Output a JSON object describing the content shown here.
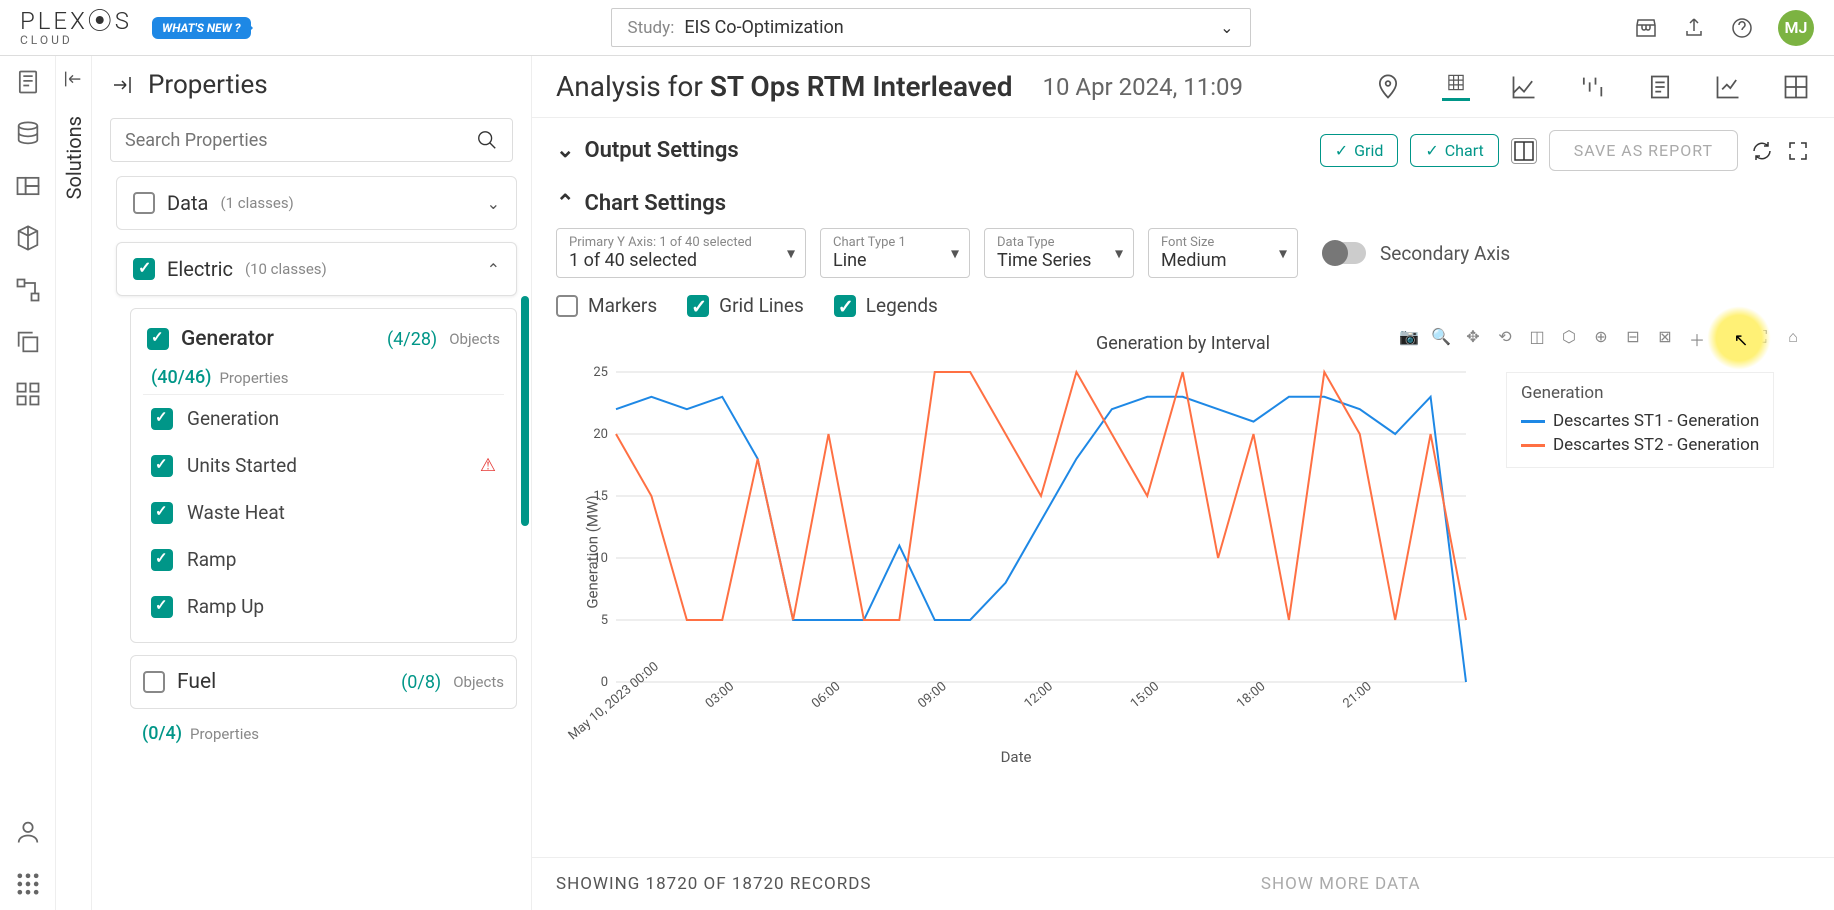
{
  "topbar": {
    "logo_main": "PLEX⦿S",
    "logo_sub": "CLOUD",
    "whats_new": "WHAT'S NEW ?",
    "study_label": "Study:",
    "study_value": "EIS Co-Optimization",
    "avatar": "MJ"
  },
  "analysis": {
    "prefix": "Analysis for ",
    "name": "ST Ops RTM Interleaved",
    "date": "10 Apr 2024, 11:09"
  },
  "props": {
    "title": "Properties",
    "search_placeholder": "Search Properties",
    "groups": {
      "data": {
        "name": "Data",
        "count": "(1 classes)"
      },
      "electric": {
        "name": "Electric",
        "count": "(10 classes)"
      }
    },
    "generator": {
      "name": "Generator",
      "ratio": "(4/28)",
      "obj_label": "Objects",
      "prop_ratio": "(40/46)",
      "prop_label": "Properties",
      "items": [
        "Generation",
        "Units Started",
        "Waste Heat",
        "Ramp",
        "Ramp Up"
      ]
    },
    "fuel": {
      "name": "Fuel",
      "ratio": "(0/8)",
      "obj_label": "Objects",
      "prop_ratio": "(0/4)",
      "prop_label": "Properties"
    }
  },
  "solutions_tab": "Solutions",
  "output": {
    "section": "Output Settings",
    "grid": "Grid",
    "chart": "Chart",
    "save": "SAVE AS REPORT"
  },
  "chart_settings": {
    "section": "Chart Settings",
    "primary_axis": {
      "label": "Primary Y Axis: 1 of 40 selected",
      "value": "1 of 40 selected"
    },
    "chart_type": {
      "label": "Chart Type 1",
      "value": "Line"
    },
    "data_type": {
      "label": "Data Type",
      "value": "Time Series"
    },
    "font_size": {
      "label": "Font Size",
      "value": "Medium"
    },
    "secondary": "Secondary Axis",
    "markers": "Markers",
    "gridlines": "Grid Lines",
    "legends": "Legends"
  },
  "chart_data": {
    "type": "line",
    "title": "Generation  by Interval",
    "xlabel": "Date",
    "ylabel": "Generation (MW)",
    "ylim": [
      0,
      25
    ],
    "yticks": [
      0,
      5,
      10,
      15,
      20,
      25
    ],
    "xticks": [
      "May 10, 2023 00:00",
      "03:00",
      "06:00",
      "09:00",
      "12:00",
      "15:00",
      "18:00",
      "21:00"
    ],
    "legend_title": "Generation",
    "series": [
      {
        "name": "Descartes ST1 - Generation",
        "color": "#1e88e5",
        "x": [
          0,
          1,
          2,
          3,
          4,
          5,
          6,
          7,
          8,
          9,
          10,
          11,
          12,
          13,
          14,
          15,
          16,
          17,
          18,
          19,
          20,
          21,
          22,
          23,
          24
        ],
        "y": [
          22,
          23,
          22,
          23,
          18,
          5,
          5,
          5,
          11,
          5,
          5,
          8,
          13,
          18,
          22,
          23,
          23,
          22,
          21,
          23,
          23,
          22,
          20,
          23,
          0
        ]
      },
      {
        "name": "Descartes ST2 - Generation",
        "color": "#ff7043",
        "x": [
          0,
          1,
          2,
          3,
          4,
          5,
          6,
          7,
          8,
          9,
          10,
          11,
          12,
          13,
          14,
          15,
          16,
          17,
          18,
          19,
          20,
          21,
          22,
          23,
          24
        ],
        "y": [
          20,
          15,
          5,
          5,
          18,
          5,
          20,
          5,
          5,
          25,
          25,
          20,
          15,
          25,
          20,
          15,
          25,
          10,
          20,
          5,
          25,
          20,
          5,
          20,
          5
        ]
      }
    ]
  },
  "footer": {
    "showing": "SHOWING 18720 OF 18720 RECORDS",
    "more": "SHOW MORE DATA"
  }
}
